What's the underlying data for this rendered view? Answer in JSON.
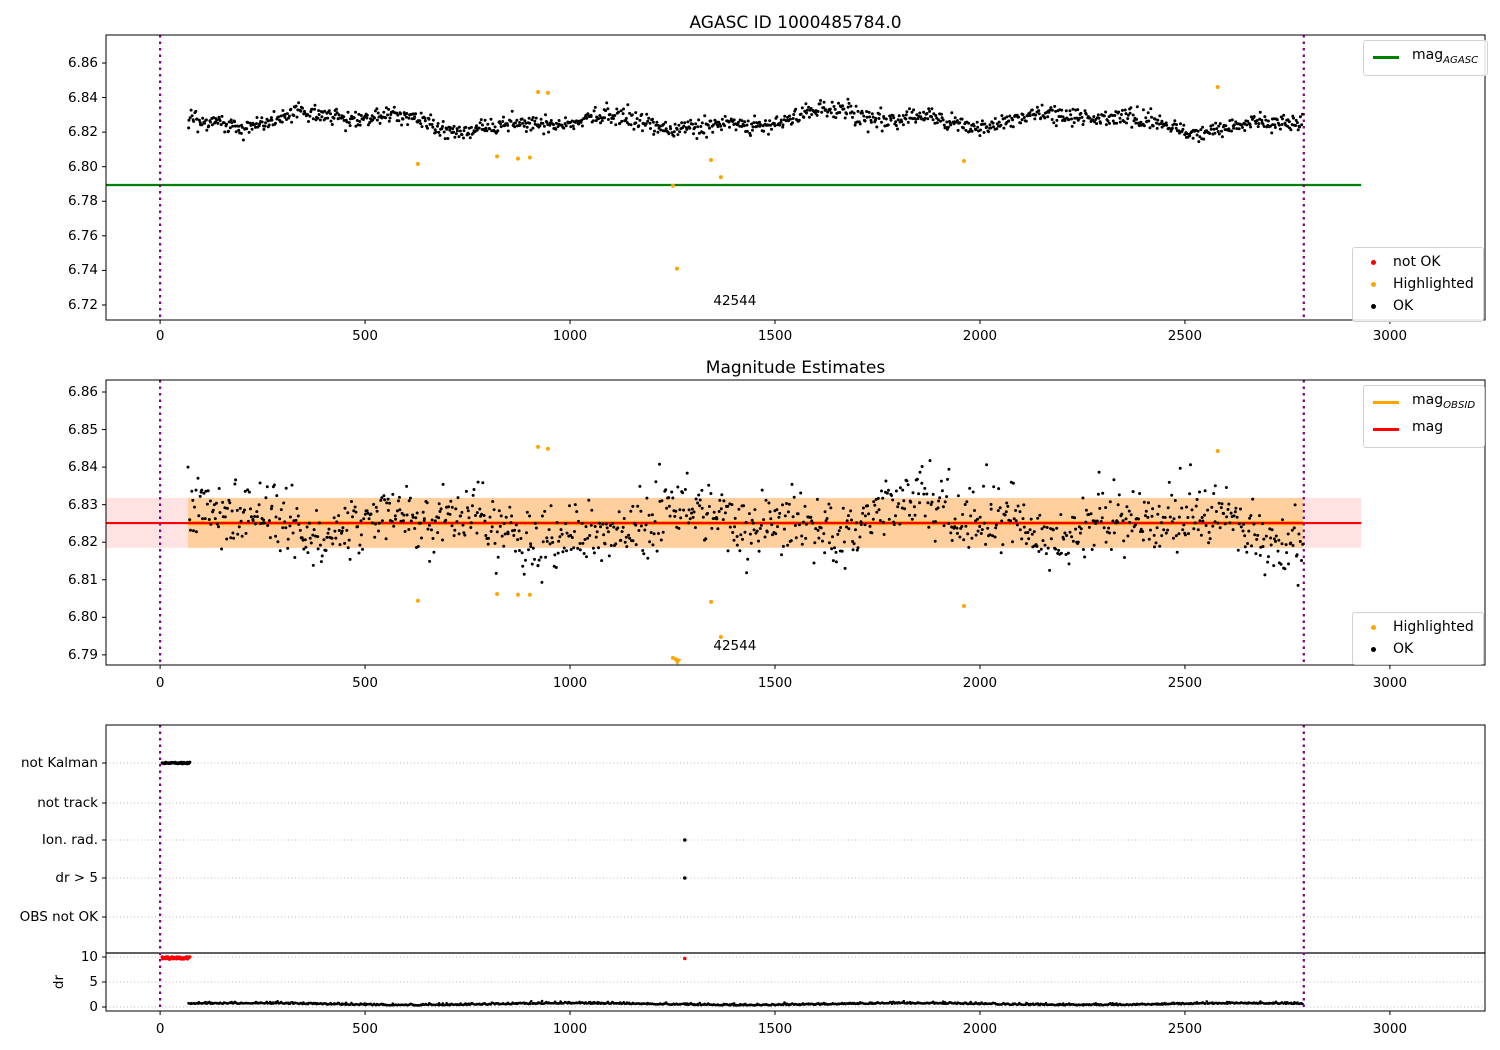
{
  "figure": {
    "background": "#ffffff"
  },
  "colors": {
    "ok": "#000000",
    "not_ok": "#ff0000",
    "highlighted": "#ffa500",
    "agasc_line": "#008000",
    "mag_line": "#ff0000",
    "obsid_line": "#ffa500",
    "obsid_vline": "#800080",
    "grid_dotted": "#bbbbbb",
    "band_pink": "rgba(255,0,0,0.11)",
    "band_orange": "rgba(255,165,0,0.30)",
    "axis": "#000000"
  },
  "legends": {
    "top_line": {
      "text": "mag",
      "sub": "AGASC",
      "color": "#008000"
    },
    "top_markers": [
      {
        "label": "not OK",
        "color": "#ff0000"
      },
      {
        "label": "Highlighted",
        "color": "#ffa500"
      },
      {
        "label": "OK",
        "color": "#000000"
      }
    ],
    "mid_line_obsid": {
      "text": "mag",
      "sub": "OBSID",
      "color": "#ffa500"
    },
    "mid_line_mag": {
      "text": "mag",
      "sub": "",
      "color": "#ff0000"
    },
    "mid_markers": [
      {
        "label": "Highlighted",
        "color": "#ffa500"
      },
      {
        "label": "OK",
        "color": "#000000"
      }
    ]
  },
  "chart_data": [
    {
      "type": "scatter",
      "title": "AGASC ID 1000485784.0",
      "xlim": [
        -132,
        3232
      ],
      "ylim": [
        6.7113,
        6.8762
      ],
      "x_ticks": [
        "0",
        "500",
        "1000",
        "1500",
        "2000",
        "2500",
        "3000"
      ],
      "x_tick_values": [
        0,
        500,
        1000,
        1500,
        2000,
        2500,
        3000
      ],
      "y_ticks": [
        "6.72",
        "6.74",
        "6.76",
        "6.78",
        "6.80",
        "6.82",
        "6.84",
        "6.86"
      ],
      "y_tick_values": [
        6.72,
        6.74,
        6.76,
        6.78,
        6.8,
        6.82,
        6.84,
        6.86
      ],
      "agasc_line": {
        "y": 6.7894,
        "x_start": -132,
        "x_end": 2930
      },
      "obsid_vlines": [
        0,
        2790
      ],
      "annotation": {
        "text": "42544",
        "x": 1402,
        "y": 6.719
      },
      "ok_series": {
        "count": 1250,
        "x_start": 68,
        "x_end": 2788,
        "mean": 6.8265,
        "min": 6.8085,
        "max": 6.8425
      },
      "highlighted_points": [
        [
          629,
          6.8016
        ],
        [
          822,
          6.806
        ],
        [
          873,
          6.8047
        ],
        [
          902,
          6.8053
        ],
        [
          922,
          6.8432
        ],
        [
          946,
          6.8427
        ],
        [
          1251,
          6.789
        ],
        [
          1261,
          6.741
        ],
        [
          1344,
          6.8039
        ],
        [
          1368,
          6.794
        ],
        [
          1961,
          6.8033
        ],
        [
          2580,
          6.8461
        ]
      ],
      "not_ok_points": []
    },
    {
      "type": "scatter",
      "title": "Magnitude Estimates",
      "xlim": [
        -132,
        3232
      ],
      "ylim": [
        6.7873,
        6.8632
      ],
      "x_ticks": [
        "0",
        "500",
        "1000",
        "1500",
        "2000",
        "2500",
        "3000"
      ],
      "x_tick_values": [
        0,
        500,
        1000,
        1500,
        2000,
        2500,
        3000
      ],
      "y_ticks": [
        "6.79",
        "6.80",
        "6.81",
        "6.82",
        "6.83",
        "6.84",
        "6.85",
        "6.86"
      ],
      "y_tick_values": [
        6.79,
        6.8,
        6.81,
        6.82,
        6.83,
        6.84,
        6.85,
        6.86
      ],
      "mag_line": {
        "y": 6.8251,
        "x_start": -132,
        "x_end": 2930
      },
      "mag_band": {
        "low": 6.8185,
        "high": 6.8318,
        "x_start": -132,
        "x_end": 2930
      },
      "obsid_line": {
        "y": 6.8251,
        "x_start": 68,
        "x_end": 2788
      },
      "obsid_band": {
        "low": 6.8185,
        "high": 6.8318,
        "x_start": 68,
        "x_end": 2788
      },
      "obsid_vlines": [
        0,
        2790
      ],
      "annotation": {
        "text": "42544",
        "x": 1402,
        "y": 6.7907
      },
      "ok_series": {
        "count": 1080,
        "x_start": 68,
        "x_end": 2788,
        "mean": 6.8252,
        "min": 6.8068,
        "max": 6.8448
      },
      "highlighted_points": [
        [
          629,
          6.8044
        ],
        [
          822,
          6.8062
        ],
        [
          873,
          6.806
        ],
        [
          902,
          6.806
        ],
        [
          922,
          6.8454
        ],
        [
          946,
          6.8449
        ],
        [
          1251,
          6.7892
        ],
        [
          1259,
          6.7888
        ],
        [
          1344,
          6.8041
        ],
        [
          1368,
          6.7948
        ],
        [
          1961,
          6.803
        ],
        [
          2580,
          6.8443
        ]
      ],
      "clipped_highlighted_points": [
        [
          1262,
          6.7876
        ]
      ]
    },
    {
      "type": "scatter-categorical",
      "row_labels": [
        "not Kalman",
        "not track",
        "Ion. rad.",
        "dr > 5",
        "OBS not OK"
      ],
      "dr_ticks": [
        "10",
        "5",
        "0"
      ],
      "dr_tick_values": [
        10,
        5,
        0
      ],
      "dr_axis_label": "dr",
      "xlim": [
        -132,
        3232
      ],
      "x_ticks": [
        "0",
        "500",
        "1000",
        "1500",
        "2000",
        "2500",
        "3000"
      ],
      "x_tick_values": [
        0,
        500,
        1000,
        1500,
        2000,
        2500,
        3000
      ],
      "threshold_line_dr": 10.8,
      "obsid_vlines": [
        0,
        2790
      ],
      "not_kalman_run": {
        "x_start": 5,
        "x_end": 73
      },
      "not_ok_dr_run": {
        "x_start": 5,
        "x_end": 73,
        "dr": 9.8
      },
      "flag_points": [
        {
          "row": "Ion. rad.",
          "x": 1280
        },
        {
          "row": "dr > 5",
          "x": 1280
        }
      ],
      "not_ok_points": [
        {
          "x": 1280,
          "dr": 9.7
        }
      ],
      "dr_series": {
        "count": 1150,
        "x_start": 68,
        "x_end": 2788,
        "mean": 0.5,
        "min": 0.08,
        "max": 1.45
      }
    }
  ]
}
